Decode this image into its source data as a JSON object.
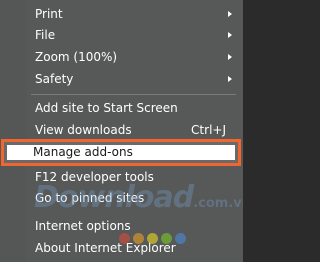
{
  "menu": {
    "print": {
      "label": "Print"
    },
    "file": {
      "label": "File"
    },
    "zoom": {
      "label": "Zoom (100%)"
    },
    "safety": {
      "label": "Safety"
    },
    "add_site": {
      "label": "Add site to Start Screen"
    },
    "view_downloads": {
      "label": "View downloads",
      "shortcut": "Ctrl+J"
    },
    "manage_addons": {
      "label": "Manage add-ons"
    },
    "dev_tools": {
      "label": "F12 developer tools"
    },
    "pinned_sites": {
      "label": "Go to pinned sites"
    },
    "internet_options": {
      "label": "Internet options"
    },
    "about": {
      "label": "About Internet Explorer"
    }
  },
  "highlight_color": "#f2652e",
  "watermark": {
    "brand": "Download",
    "tld": ".com.vn"
  },
  "watermark_dot_colors": [
    "#e64a3b",
    "#f5a623",
    "#f8e71c",
    "#7ed321",
    "#4a90e2"
  ]
}
